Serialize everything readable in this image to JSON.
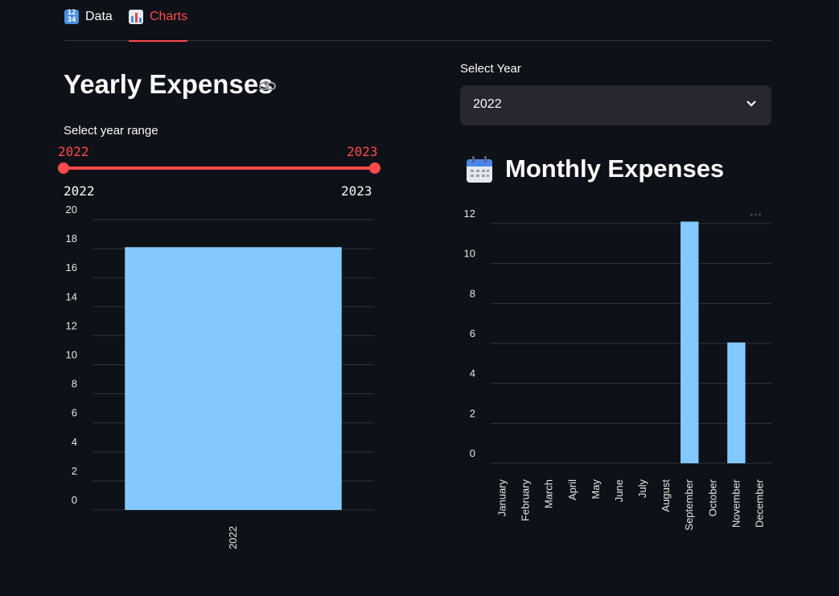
{
  "tabs": [
    {
      "label": "Data",
      "icon": "numbers-icon"
    },
    {
      "label": "Charts",
      "icon": "bar-chart-icon",
      "active": true
    }
  ],
  "yearly": {
    "title": "Yearly Expenses",
    "range_label": "Select year range",
    "range_min_value": "2022",
    "range_max_value": "2023",
    "range_min_bound": "2022",
    "range_max_bound": "2023"
  },
  "monthly": {
    "select_label": "Select Year",
    "selected_year": "2022",
    "title": "Monthly Expenses"
  },
  "colors": {
    "accent": "#ff4b4b",
    "bar": "#83c9ff",
    "background": "#0e1117",
    "select_bg": "#262730"
  },
  "chart_data": [
    {
      "type": "bar",
      "categories": [
        "2022"
      ],
      "values": [
        18.1
      ],
      "ylim": [
        0,
        20
      ],
      "yticks": [
        0,
        2,
        4,
        6,
        8,
        10,
        12,
        14,
        16,
        18,
        20
      ],
      "grid": true
    },
    {
      "type": "bar",
      "categories": [
        "January",
        "February",
        "March",
        "April",
        "May",
        "June",
        "July",
        "August",
        "September",
        "October",
        "November",
        "December"
      ],
      "values": [
        0,
        0,
        0,
        0,
        0,
        0,
        0,
        0,
        12.1,
        0,
        6.05,
        0
      ],
      "ylim": [
        0,
        12
      ],
      "yticks": [
        0,
        2,
        4,
        6,
        8,
        10,
        12
      ],
      "grid": true
    }
  ]
}
